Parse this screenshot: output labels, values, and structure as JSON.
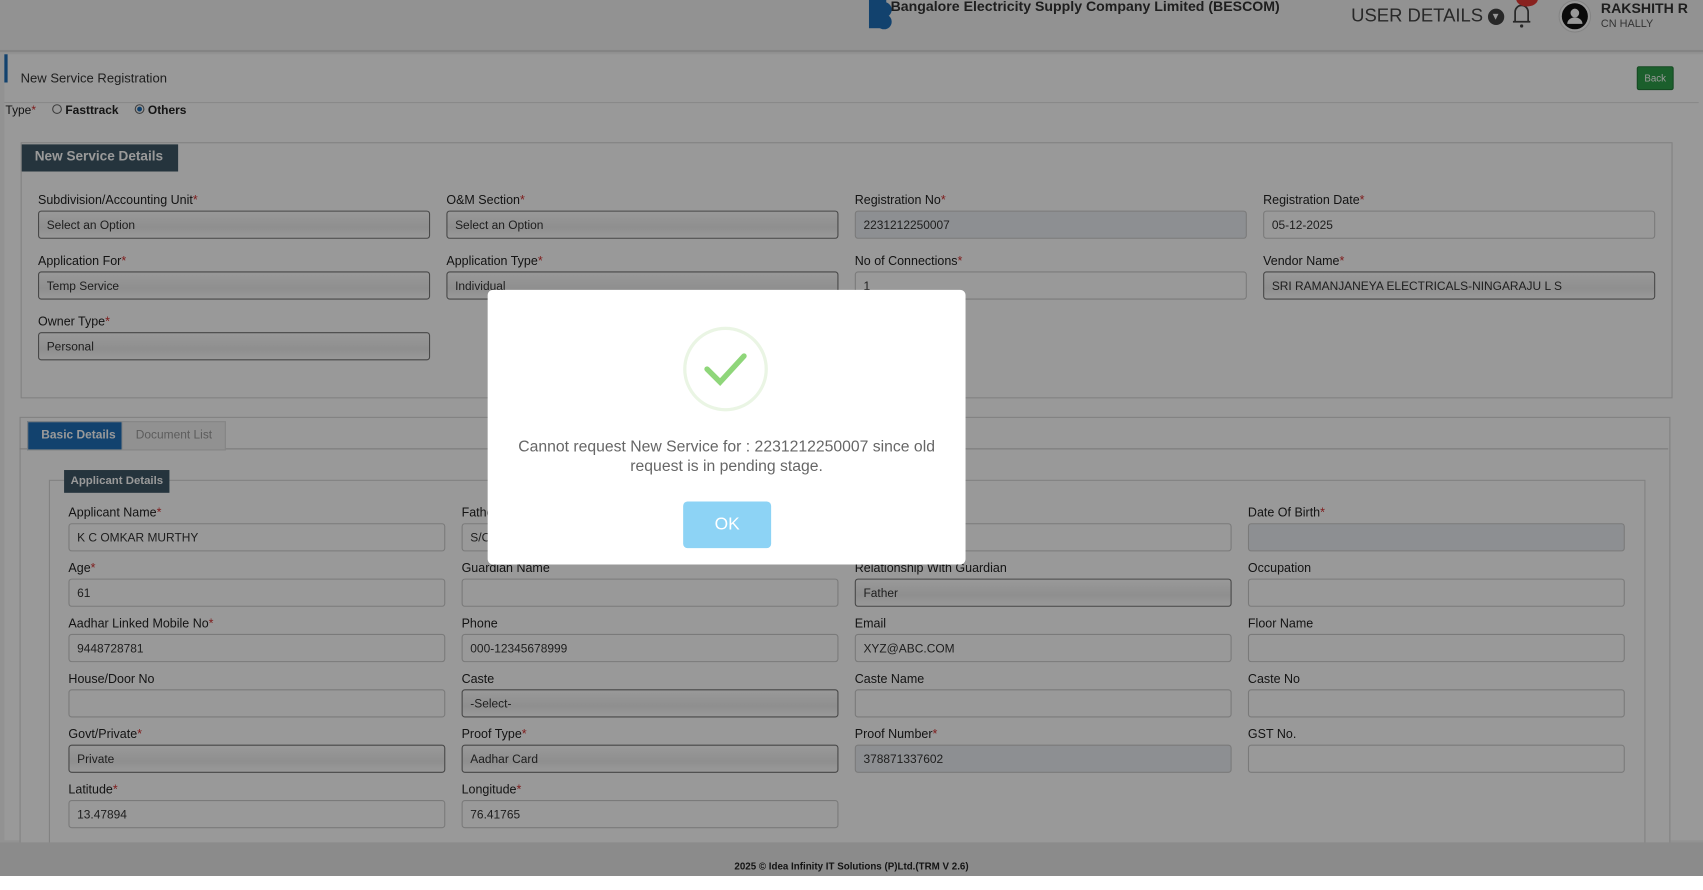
{
  "header": {
    "company": "Bangalore Electricity Supply Company Limited (BESCOM)",
    "logo_text": "BESCOM",
    "user_details": "USER DETAILS",
    "user_name": "RAKSHITH R",
    "user_location": "CN HALLY"
  },
  "page": {
    "title": "New Service Registration",
    "back": "Back",
    "type_label": "Type",
    "type_options": [
      "Fasttrack",
      "Others"
    ],
    "type_selected": "Others"
  },
  "service_details": {
    "legend": "New Service Details",
    "fields": [
      {
        "label": "Subdivision/Accounting Unit",
        "required": true,
        "value": "Select an Option",
        "kind": "sel"
      },
      {
        "label": "O&M Section",
        "required": true,
        "value": "Select an Option",
        "kind": "sel"
      },
      {
        "label": "Registration No",
        "required": true,
        "value": "2231212250007",
        "kind": "ro"
      },
      {
        "label": "Registration Date",
        "required": true,
        "value": "05-12-2025",
        "kind": "txt"
      },
      {
        "label": "Application For",
        "required": true,
        "value": "Temp Service",
        "kind": "sel"
      },
      {
        "label": "Application Type",
        "required": true,
        "value": "Individual",
        "kind": "sel"
      },
      {
        "label": "No of Connections",
        "required": true,
        "value": "1",
        "kind": "txt"
      },
      {
        "label": "Vendor Name",
        "required": true,
        "value": "SRI RAMANJANEYA ELECTRICALS-NINGARAJU L S",
        "kind": "sel"
      },
      {
        "label": "Owner Type",
        "required": true,
        "value": "Personal",
        "kind": "sel"
      }
    ]
  },
  "tabs": [
    "Basic Details",
    "Document List"
  ],
  "applicant": {
    "legend": "Applicant Details",
    "fields": [
      {
        "label": "Applicant Name",
        "required": true,
        "value": "K C OMKAR MURTHY",
        "kind": "txt"
      },
      {
        "label": "Father",
        "required": false,
        "value": "S/O",
        "kind": "txt"
      },
      {
        "label": "",
        "required": false,
        "value": "",
        "kind": "txt"
      },
      {
        "label": "Date Of Birth",
        "required": true,
        "value": "",
        "kind": "ro"
      },
      {
        "label": "Age",
        "required": true,
        "value": "61",
        "kind": "txt"
      },
      {
        "label": "Guardian Name",
        "required": false,
        "value": "",
        "kind": "txt"
      },
      {
        "label": "Relationship With Guardian",
        "required": false,
        "value": "Father",
        "kind": "sel"
      },
      {
        "label": "Occupation",
        "required": false,
        "value": "",
        "kind": "txt"
      },
      {
        "label": "Aadhar Linked Mobile No",
        "required": true,
        "value": "9448728781",
        "kind": "txt"
      },
      {
        "label": "Phone",
        "required": false,
        "value": "000-12345678999",
        "kind": "txt"
      },
      {
        "label": "Email",
        "required": false,
        "value": "XYZ@ABC.COM",
        "kind": "txt"
      },
      {
        "label": "Floor Name",
        "required": false,
        "value": "",
        "kind": "txt"
      },
      {
        "label": "House/Door No",
        "required": false,
        "value": "",
        "kind": "txt"
      },
      {
        "label": "Caste",
        "required": false,
        "value": "-Select-",
        "kind": "sel"
      },
      {
        "label": "Caste Name",
        "required": false,
        "value": "",
        "kind": "txt"
      },
      {
        "label": "Caste No",
        "required": false,
        "value": "",
        "kind": "txt"
      },
      {
        "label": "Govt/Private",
        "required": true,
        "value": "Private",
        "kind": "sel"
      },
      {
        "label": "Proof Type",
        "required": true,
        "value": "Aadhar Card",
        "kind": "sel"
      },
      {
        "label": "Proof Number",
        "required": true,
        "value": "378871337602",
        "kind": "ro"
      },
      {
        "label": "GST No.",
        "required": false,
        "value": "",
        "kind": "txt"
      },
      {
        "label": "Latitude",
        "required": true,
        "value": "13.47894",
        "kind": "txt"
      },
      {
        "label": "Longitude",
        "required": true,
        "value": "76.41765",
        "kind": "txt"
      }
    ]
  },
  "footer": "2025 © Idea Infinity IT Solutions (P)Ltd.(TRM V 2.6)",
  "modal": {
    "icon": "check-circle-icon",
    "message": "Cannot request New Service for : 2231212250007 since old request is in pending stage.",
    "ok": "OK",
    "accent": "#8dd3f5",
    "check_color": "#8fd67a"
  }
}
